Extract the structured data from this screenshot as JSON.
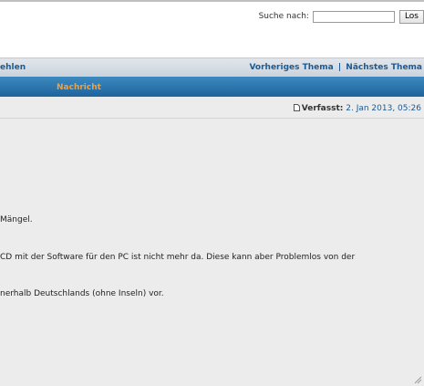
{
  "search": {
    "label": "Suche nach:",
    "value": "",
    "button": "Los"
  },
  "nav": {
    "left_label": "ehlen",
    "prev_label": "Vorheriges Thema",
    "separator": "|",
    "next_label": "Nächstes Thema"
  },
  "table_header": {
    "title": "Nachricht"
  },
  "post": {
    "meta_label": "Verfasst:",
    "date": "2. Jan 2013, 05:26",
    "lines": [
      "Mängel.",
      "CD mit der Software für den PC ist nicht mehr da. Diese kann aber Problemlos von der",
      "nerhalb Deutschlands (ohne Inseln) vor."
    ]
  },
  "colors": {
    "link": "#1a5a96",
    "header_bg": "#2a73ab",
    "header_text": "#f3a03b",
    "content_bg": "#ececec"
  }
}
